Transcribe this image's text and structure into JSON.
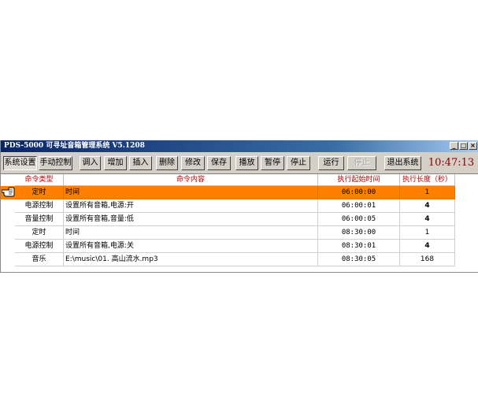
{
  "window": {
    "title": "PDS-5000  可寻址音箱管理系统 V5.1208",
    "controls": [
      "_",
      "□",
      "×"
    ]
  },
  "toolbar": {
    "buttons": [
      {
        "label": "系统设置",
        "pressed": true
      },
      {
        "label": "手动控制"
      },
      {
        "label": "调入"
      },
      {
        "label": "增加"
      },
      {
        "label": "插入"
      },
      {
        "label": "删除"
      },
      {
        "label": "修改"
      },
      {
        "label": "保存"
      },
      {
        "label": "播放"
      },
      {
        "label": "暂停"
      },
      {
        "label": "停止"
      },
      {
        "label": "运行"
      },
      {
        "label": "停止",
        "disabled": true
      },
      {
        "label": "退出系统"
      }
    ],
    "clock": "10:47:13"
  },
  "table": {
    "columns": [
      "命令类型",
      "命令内容",
      "执行起始时间",
      "执行长度（秒）"
    ],
    "rows": [
      {
        "type": "定时",
        "content": "时间",
        "time": "06:00:00",
        "duration": "1",
        "selected": true
      },
      {
        "type": "电源控制",
        "content": "设置所有音箱,电源:开",
        "time": "06:00:01",
        "duration": "4"
      },
      {
        "type": "音量控制",
        "content": "设置所有音箱,音量:低",
        "time": "06:00:05",
        "duration": "4"
      },
      {
        "type": "定时",
        "content": "时间",
        "time": "08:30:00",
        "duration": "1"
      },
      {
        "type": "电源控制",
        "content": "设置所有音箱,电源:关",
        "time": "08:30:01",
        "duration": "4"
      },
      {
        "type": "音乐",
        "content": "E:\\music\\01. 高山流水.mp3",
        "time": "08:30:05",
        "duration": "168"
      }
    ]
  },
  "colors": {
    "title_bar": "#0a246a",
    "selected_row": "#ff8000",
    "header_text": "#b00000",
    "clock_text": "#8b0000"
  }
}
